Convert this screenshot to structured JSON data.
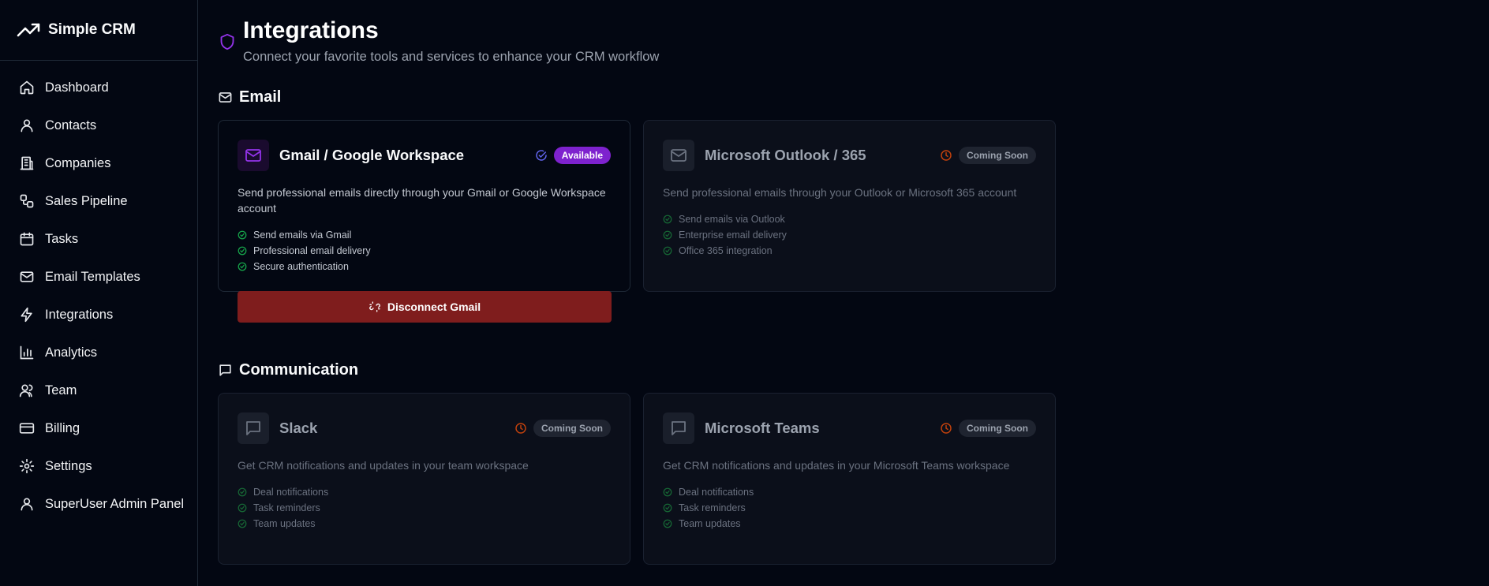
{
  "app": {
    "name": "Simple CRM"
  },
  "sidebar": {
    "items": [
      {
        "label": "Dashboard",
        "icon": "home-icon"
      },
      {
        "label": "Contacts",
        "icon": "user-icon"
      },
      {
        "label": "Companies",
        "icon": "building-icon"
      },
      {
        "label": "Sales Pipeline",
        "icon": "workflow-icon"
      },
      {
        "label": "Tasks",
        "icon": "calendar-icon"
      },
      {
        "label": "Email Templates",
        "icon": "mail-icon"
      },
      {
        "label": "Integrations",
        "icon": "zap-icon"
      },
      {
        "label": "Analytics",
        "icon": "bar-chart-icon"
      },
      {
        "label": "Team",
        "icon": "users-icon"
      },
      {
        "label": "Billing",
        "icon": "credit-card-icon"
      },
      {
        "label": "Settings",
        "icon": "gear-icon"
      },
      {
        "label": "SuperUser Admin Panel",
        "icon": "user-icon"
      }
    ]
  },
  "page": {
    "title": "Integrations",
    "subtitle": "Connect your favorite tools and services to enhance your CRM workflow"
  },
  "sections": [
    {
      "title": "Email",
      "cards": [
        {
          "name": "Gmail / Google Workspace",
          "status": "Available",
          "description": "Send professional emails directly through your Gmail or Google Workspace account",
          "features": [
            "Send emails via Gmail",
            "Professional email delivery",
            "Secure authentication"
          ],
          "action": "Disconnect Gmail"
        },
        {
          "name": "Microsoft Outlook / 365",
          "status": "Coming Soon",
          "description": "Send professional emails through your Outlook or Microsoft 365 account",
          "features": [
            "Send emails via Outlook",
            "Enterprise email delivery",
            "Office 365 integration"
          ]
        }
      ]
    },
    {
      "title": "Communication",
      "cards": [
        {
          "name": "Slack",
          "status": "Coming Soon",
          "description": "Get CRM notifications and updates in your team workspace",
          "features": [
            "Deal notifications",
            "Task reminders",
            "Team updates"
          ]
        },
        {
          "name": "Microsoft Teams",
          "status": "Coming Soon",
          "description": "Get CRM notifications and updates in your Microsoft Teams workspace",
          "features": [
            "Deal notifications",
            "Task reminders",
            "Team updates"
          ]
        }
      ]
    }
  ],
  "colors": {
    "accent": "#9333ea",
    "available_badge": "#7e22ce",
    "danger_button": "#7f1d1d",
    "coming_soon_clock": "#c2410c",
    "feature_check": "#16a34a"
  }
}
